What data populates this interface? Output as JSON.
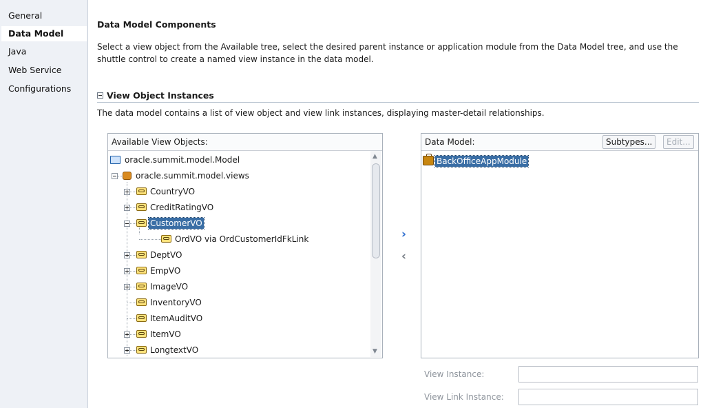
{
  "nav": {
    "items": [
      {
        "label": "General",
        "selected": false
      },
      {
        "label": "Data Model",
        "selected": true
      },
      {
        "label": "Java",
        "selected": false
      },
      {
        "label": "Web Service",
        "selected": false
      },
      {
        "label": "Configurations",
        "selected": false
      }
    ]
  },
  "main": {
    "title": "Data Model Components",
    "description": "Select a view object from the Available tree, select the desired parent instance or application module from the Data Model tree, and use the shuttle control to create a named view instance in the data model.",
    "section": {
      "title": "View Object Instances",
      "description": "The data model contains a list of view object and view link instances, displaying master-detail relationships."
    }
  },
  "available": {
    "label": "Available View Objects:",
    "nodes": [
      {
        "label": "oracle.summit.model.Model",
        "icon": "folder-icon"
      },
      {
        "label": "oracle.summit.model.views",
        "icon": "package-icon"
      },
      {
        "label": "CountryVO",
        "icon": "view-object-icon"
      },
      {
        "label": "CreditRatingVO",
        "icon": "view-object-icon"
      },
      {
        "label": "CustomerVO",
        "icon": "view-object-icon",
        "selected": true
      },
      {
        "label": "OrdVO via OrdCustomerIdFkLink",
        "icon": "view-object-icon"
      },
      {
        "label": "DeptVO",
        "icon": "view-object-icon"
      },
      {
        "label": "EmpVO",
        "icon": "view-object-icon"
      },
      {
        "label": "ImageVO",
        "icon": "view-object-icon"
      },
      {
        "label": "InventoryVO",
        "icon": "view-object-icon"
      },
      {
        "label": "ItemAuditVO",
        "icon": "view-object-icon"
      },
      {
        "label": "ItemVO",
        "icon": "view-object-icon"
      },
      {
        "label": "LongtextVO",
        "icon": "view-object-icon"
      }
    ]
  },
  "shuttle": {
    "add_icon": "chevron-right-icon",
    "add_glyph": "›",
    "remove_icon": "chevron-left-icon",
    "remove_glyph": "‹",
    "add_color": "#2f6fd0",
    "remove_color": "#7a8088"
  },
  "data_model": {
    "label": "Data Model:",
    "subtypes_label": "Subtypes...",
    "edit_label": "Edit...",
    "root": {
      "label": "BackOfficeAppModule",
      "icon": "application-module-icon",
      "selected": true
    }
  },
  "fields": {
    "view_instance_label": "View Instance:",
    "view_instance_value": "",
    "view_link_instance_label": "View Link Instance:",
    "view_link_instance_value": ""
  },
  "colors": {
    "selection": "#3a6ea5",
    "nav_background": "#eef1f6"
  }
}
